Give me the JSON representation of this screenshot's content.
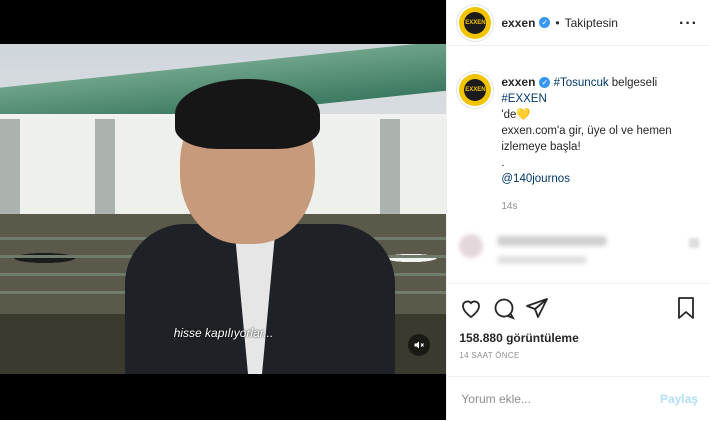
{
  "media": {
    "subtitle": "hisse kapılıyorlar...",
    "mute_icon": "speaker-muted-icon"
  },
  "header": {
    "avatar_text": "EXXEN",
    "username": "exxen",
    "separator": "•",
    "follow_status": "Takiptesin",
    "more_icon": "more-icon"
  },
  "caption": {
    "avatar_text": "EXXEN",
    "username": "exxen",
    "hashtag1": "#Tosuncuk",
    "text1": " belgeseli ",
    "hashtag2": "#EXXEN",
    "text2": "'de💛",
    "line2": "exxen.com'a gir, üye ol ve hemen izlemeye başla!",
    "dot": ".",
    "mention": "@140journos",
    "time": "14s"
  },
  "actions": {
    "views": "158.880 görüntüleme",
    "time_ago": "14 SAAT ÖNCE"
  },
  "comment_box": {
    "placeholder": "Yorum ekle...",
    "post_label": "Paylaş"
  }
}
